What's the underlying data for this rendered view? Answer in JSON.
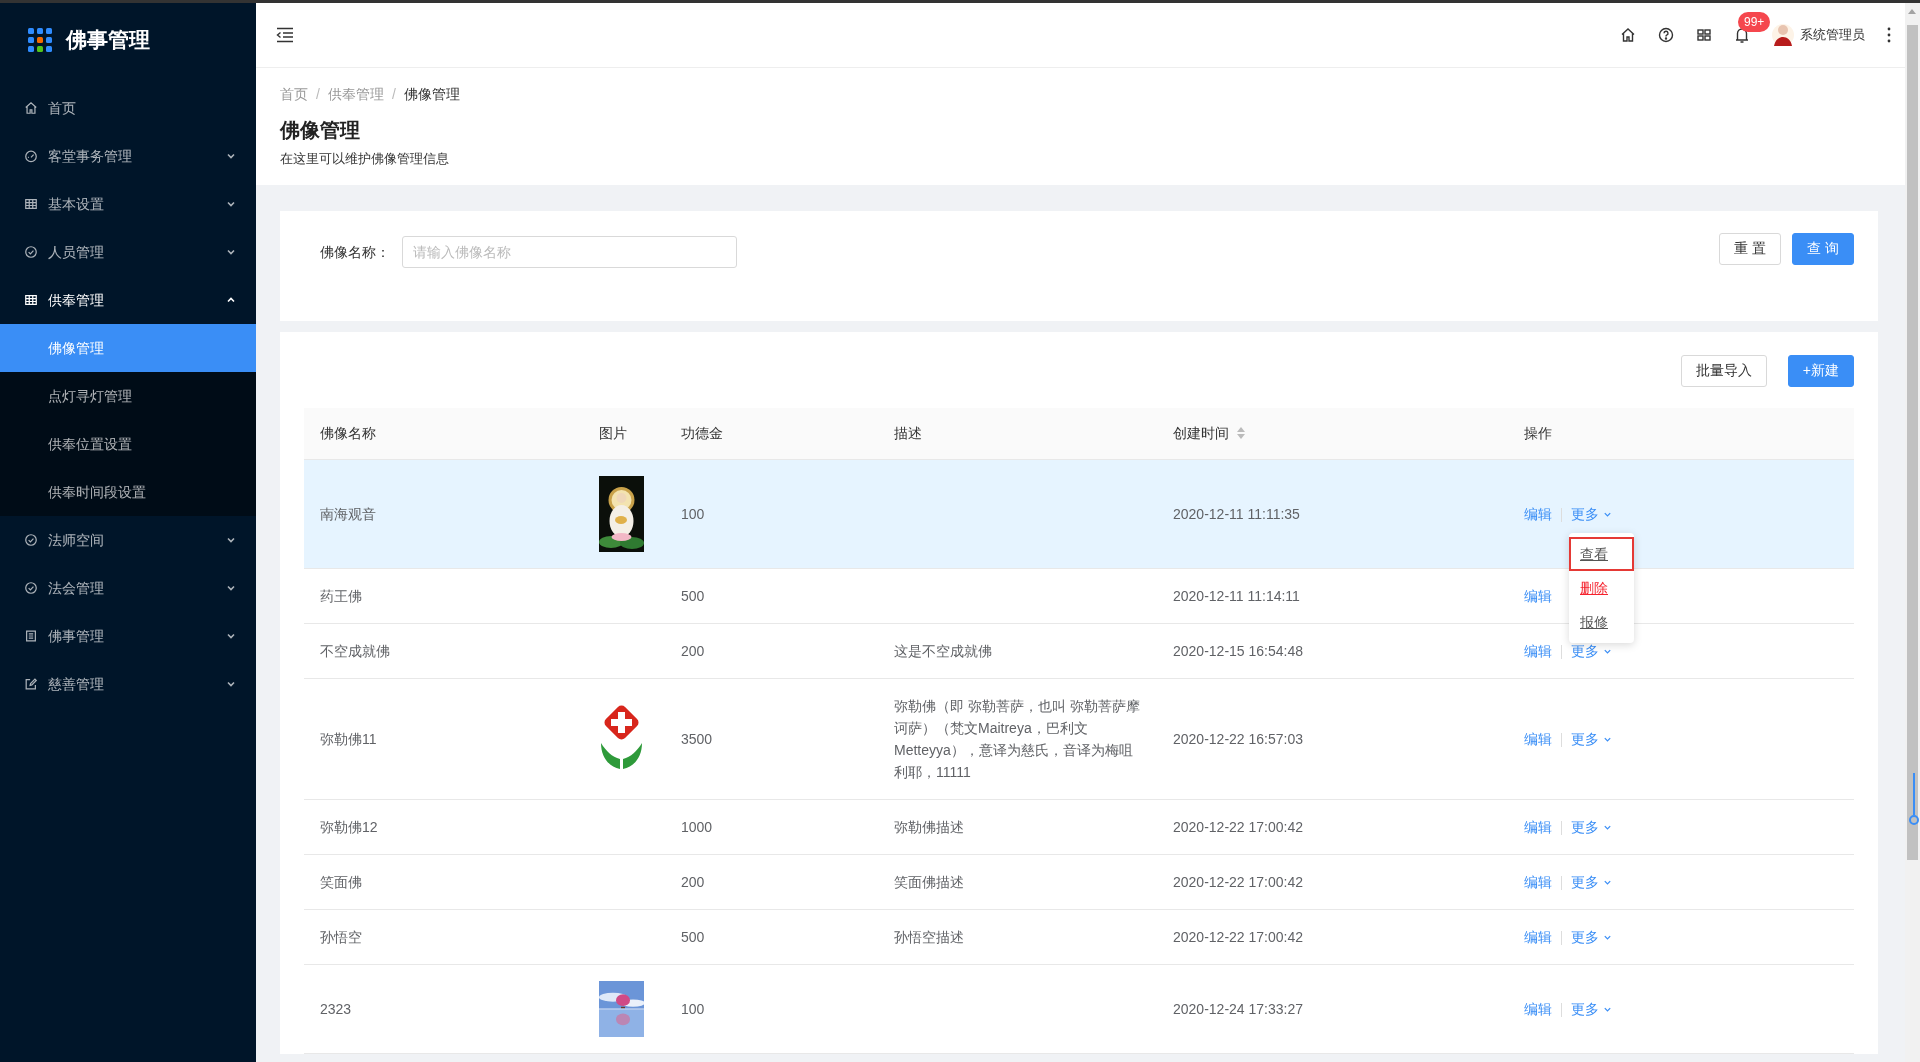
{
  "sidebar": {
    "title": "佛事管理",
    "items": [
      {
        "label": "首页"
      },
      {
        "label": "客堂事务管理",
        "expanded": false
      },
      {
        "label": "基本设置",
        "expanded": false
      },
      {
        "label": "人员管理",
        "expanded": false
      },
      {
        "label": "供奉管理",
        "expanded": true,
        "children": [
          {
            "label": "佛像管理",
            "selected": true
          },
          {
            "label": "点灯寻灯管理",
            "selected": false
          },
          {
            "label": "供奉位置设置",
            "selected": false
          },
          {
            "label": "供奉时间段设置",
            "selected": false
          }
        ]
      },
      {
        "label": "法师空间",
        "expanded": false
      },
      {
        "label": "法会管理",
        "expanded": false
      },
      {
        "label": "佛事管理",
        "expanded": false
      },
      {
        "label": "慈善管理",
        "expanded": false
      }
    ]
  },
  "header": {
    "notification_badge": "99+",
    "user_name": "系统管理员"
  },
  "breadcrumb": [
    {
      "label": "首页",
      "separator": "/"
    },
    {
      "label": "供奉管理",
      "separator": "/"
    },
    {
      "label": "佛像管理"
    }
  ],
  "page_title": "佛像管理",
  "page_subtitle": "在这里可以维护佛像管理信息",
  "search": {
    "fields": [
      {
        "label": "佛像名称：",
        "placeholder": "请输入佛像名称"
      }
    ],
    "buttons": [
      {
        "label": "重 置",
        "kind": "default"
      },
      {
        "label": "查 询",
        "kind": "primary"
      }
    ]
  },
  "toolbar": [
    {
      "label": "批量导入",
      "kind": "default"
    },
    {
      "label": "+新建",
      "kind": "primary"
    }
  ],
  "table": {
    "columns": [
      {
        "label": "佛像名称",
        "sortable": false
      },
      {
        "label": "图片",
        "sortable": false
      },
      {
        "label": "功德金",
        "sortable": false
      },
      {
        "label": "描述",
        "sortable": false
      },
      {
        "label": "创建时间",
        "sortable": true
      },
      {
        "label": "操作",
        "sortable": false
      }
    ],
    "rows": [
      {
        "name": "南海观音",
        "image": {
          "kind": "picture"
        },
        "amount": "100",
        "created": "2020-12-11 11:11:35",
        "actions": [
          "编辑",
          "更多"
        ],
        "highlighted": true,
        "menu": {
          "items": [
            {
              "label": "查看",
              "kind": "normal",
              "outlined": true
            },
            {
              "label": "删除",
              "kind": "danger",
              "outlined": false
            },
            {
              "label": "报修",
              "kind": "normal",
              "outlined": false
            }
          ]
        }
      },
      {
        "name": "药王佛",
        "amount": "500",
        "created": "2020-12-11 11:14:11",
        "actions": [
          "编辑"
        ],
        "highlighted": false
      },
      {
        "name": "不空成就佛",
        "amount": "200",
        "description": "这是不空成就佛",
        "created": "2020-12-15 16:54:48",
        "actions": [
          "编辑",
          "更多"
        ],
        "highlighted": false
      },
      {
        "name": "弥勒佛11",
        "image": {
          "kind": "picture"
        },
        "amount": "3500",
        "description": "弥勒佛（即 弥勒菩萨，也叫 弥勒菩萨摩诃萨）（梵文Maitreya，巴利文Metteyya），意译为慈氏，音译为梅咀利耶，11111",
        "created": "2020-12-22 16:57:03",
        "actions": [
          "编辑",
          "更多"
        ],
        "highlighted": false
      },
      {
        "name": "弥勒佛12",
        "amount": "1000",
        "description": "弥勒佛描述",
        "created": "2020-12-22 17:00:42",
        "actions": [
          "编辑",
          "更多"
        ],
        "highlighted": false
      },
      {
        "name": "笑面佛",
        "amount": "200",
        "description": "笑面佛描述",
        "created": "2020-12-22 17:00:42",
        "actions": [
          "编辑",
          "更多"
        ],
        "highlighted": false
      },
      {
        "name": "孙悟空",
        "amount": "500",
        "description": "孙悟空描述",
        "created": "2020-12-22 17:00:42",
        "actions": [
          "编辑",
          "更多"
        ],
        "highlighted": false
      },
      {
        "name": "2323",
        "image": {
          "kind": "picture"
        },
        "amount": "100",
        "created": "2020-12-24 17:33:27",
        "actions": [
          "编辑",
          "更多"
        ],
        "highlighted": false
      }
    ]
  }
}
